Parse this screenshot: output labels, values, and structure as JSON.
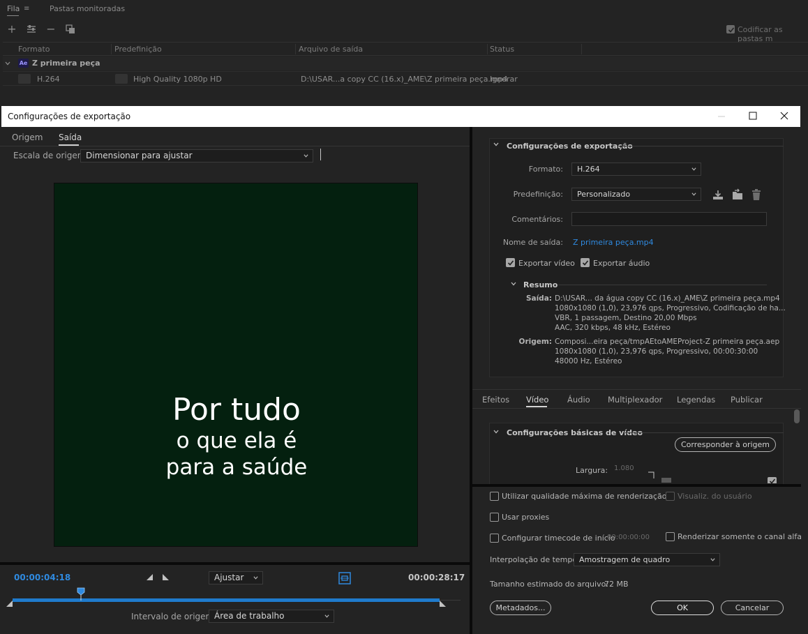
{
  "queue": {
    "tabs": [
      "Fila",
      "Pastas monitoradas"
    ],
    "auto_encode_label": "Codificar as pastas m",
    "columns": [
      "Formato",
      "Predefinição",
      "Arquivo de saída",
      "Status"
    ],
    "group_name": "Z primeira peça",
    "group_badge": "Ae",
    "row": {
      "format": "H.264",
      "preset": "High Quality 1080p HD",
      "output": "D:\\USAR...a copy CC (16.x)_AME\\Z primeira peça.mp4",
      "status": "Ignorar"
    }
  },
  "dialog": {
    "title": "Configurações de exportação"
  },
  "left": {
    "tabs": [
      "Origem",
      "Saída"
    ],
    "source_scale_label": "Escala de origem:",
    "source_scale_value": "Dimensionar para ajustar",
    "preview_text": [
      "Por tudo",
      "o que ela é",
      "para a saúde"
    ],
    "current_time": "00:00:04:18",
    "end_time": "00:00:28:17",
    "fit_value": "Ajustar",
    "source_range_label": "Intervalo de origem:",
    "source_range_value": "Área de trabalho",
    "playhead_position": 0.16
  },
  "right": {
    "export_settings_title": "Configurações de exportação",
    "format_label": "Formato:",
    "format_value": "H.264",
    "preset_label": "Predefinição:",
    "preset_value": "Personalizado",
    "comments_label": "Comentários:",
    "comments_value": "",
    "output_name_label": "Nome de saída:",
    "output_name_value": "Z primeira peça.mp4",
    "export_video_label": "Exportar vídeo",
    "export_audio_label": "Exportar áudio",
    "summary_title": "Resumo",
    "summary_output_key": "Saída:",
    "summary_output_lines": [
      "D:\\USAR... da água copy CC (16.x)_AME\\Z primeira peça.mp4",
      "1080x1080 (1,0), 23,976 qps, Progressivo, Codificação de ha...",
      "VBR, 1 passagem, Destino 20,00 Mbps",
      "AAC, 320 kbps, 48 kHz, Estéreo"
    ],
    "summary_source_key": "Origem:",
    "summary_source_lines": [
      "Composi...eira peça/tmpAEtoAMEProject-Z primeira peça.aep",
      "1080x1080 (1,0), 23,976 qps, Progressivo, 00:00:30:00",
      "48000 Hz, Estéreo"
    ],
    "tabs": [
      "Efeitos",
      "Vídeo",
      "Áudio",
      "Multiplexador",
      "Legendas",
      "Publicar"
    ],
    "basic_video_title": "Configurações básicas de vídeo",
    "match_source_label": "Corresponder à origem",
    "width_label": "Largura:",
    "width_value": "1.080",
    "max_render_label": "Utilizar qualidade máxima de renderização",
    "user_view_label": "Visualiz. do usuário",
    "use_proxies_label": "Usar proxies",
    "timecode_label": "Configurar timecode de início",
    "timecode_value": "00:00:00:00",
    "alpha_only_label": "Renderizar somente o canal alfa",
    "time_interp_label": "Interpolação de tempo:",
    "time_interp_value": "Amostragem de quadro",
    "file_size_label": "Tamanho estimado do arquivo:",
    "file_size_value": "72 MB",
    "metadata_label": "Metadados...",
    "ok_label": "OK",
    "cancel_label": "Cancelar"
  },
  "colors": {
    "accent_blue": "#2f8ae0",
    "preview_bg": "#04200f",
    "panel_bg": "#232323"
  },
  "icons": [
    "plus-icon",
    "settings-sliders-icon",
    "minus-icon",
    "duplicate-icon",
    "chevron-down-icon",
    "save-preset-icon",
    "import-preset-icon",
    "trash-icon",
    "minimize-icon",
    "maximize-icon",
    "close-icon",
    "mark-in-icon",
    "mark-out-icon",
    "fit-frame-icon",
    "link-icon",
    "checkmark-icon"
  ]
}
